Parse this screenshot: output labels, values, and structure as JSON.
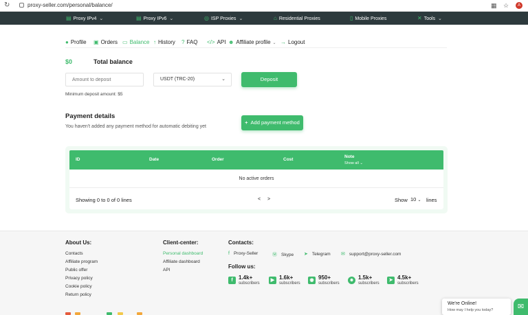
{
  "browser": {
    "url": "proxy-seller.com/personal/balance/",
    "avatar_letter": "A"
  },
  "topnav": {
    "items": [
      {
        "label": "Proxy IPv4",
        "icon": "server-icon"
      },
      {
        "label": "Proxy IPv6",
        "icon": "server-icon"
      },
      {
        "label": "ISP Proxies",
        "icon": "globe-icon"
      },
      {
        "label": "Residential Proxies",
        "icon": "home-icon"
      },
      {
        "label": "Mobile Proxies",
        "icon": "phone-icon"
      },
      {
        "label": "Tools",
        "icon": "tools-icon"
      }
    ]
  },
  "subnav": {
    "tabs": [
      {
        "label": "Profile"
      },
      {
        "label": "Orders"
      },
      {
        "label": "Balance"
      },
      {
        "label": "History"
      },
      {
        "label": "FAQ"
      },
      {
        "label": "API"
      },
      {
        "label": "Affiliate profile"
      },
      {
        "label": "Logout"
      }
    ]
  },
  "balance": {
    "amount": "$0",
    "title": "Total balance",
    "amount_placeholder": "Amount to deposit",
    "currency": "USDT (TRC-20)",
    "deposit_label": "Deposit",
    "min_note": "Minimum deposit amount: $5"
  },
  "payment": {
    "title": "Payment details",
    "subtitle": "You haven't added any payment method for automatic debiting yet",
    "add_label": "Add payment method"
  },
  "table": {
    "columns": [
      "ID",
      "Date",
      "Order",
      "Cost",
      "Note"
    ],
    "note_toggle": "Show all",
    "empty": "No active orders",
    "showing": "Showing 0 to 0 of 0 lines",
    "prev": "<",
    "next": ">",
    "show_label": "Show",
    "page_size": "10",
    "lines_label": "lines"
  },
  "footer": {
    "about": {
      "title": "About Us:",
      "links": [
        "Contacts",
        "Affiliate program",
        "Public offer",
        "Privacy policy",
        "Cookie policy",
        "Return policy"
      ]
    },
    "client": {
      "title": "Client-center:",
      "links": [
        "Personal dashboard",
        "Affiliate dashboard",
        "API"
      ]
    },
    "contacts": {
      "title": "Contacts:",
      "items": [
        {
          "label": "Proxy-Seller",
          "icon": "facebook-icon"
        },
        {
          "label": "Skype",
          "icon": "skype-icon"
        },
        {
          "label": "Telegram",
          "icon": "telegram-icon"
        },
        {
          "label": "support@proxy-seller.com",
          "icon": "mail-icon"
        }
      ]
    },
    "follow": {
      "title": "Follow us:",
      "items": [
        {
          "count": "1.4k+",
          "sub": "subscribers",
          "icon": "facebook-icon"
        },
        {
          "count": "1.6k+",
          "sub": "subscribers",
          "icon": "youtube-icon"
        },
        {
          "count": "950+",
          "sub": "subscribers",
          "icon": "discord-icon"
        },
        {
          "count": "1.5k+",
          "sub": "subscribers",
          "icon": "reddit-icon"
        },
        {
          "count": "4.5k+",
          "sub": "subscribers",
          "icon": "telegram-icon"
        }
      ]
    }
  },
  "chat": {
    "title": "We're Online!",
    "subtitle": "How may I help you today?"
  },
  "colors": {
    "accent": "#3fbb6d",
    "nav_bg": "#2d3a3d"
  }
}
